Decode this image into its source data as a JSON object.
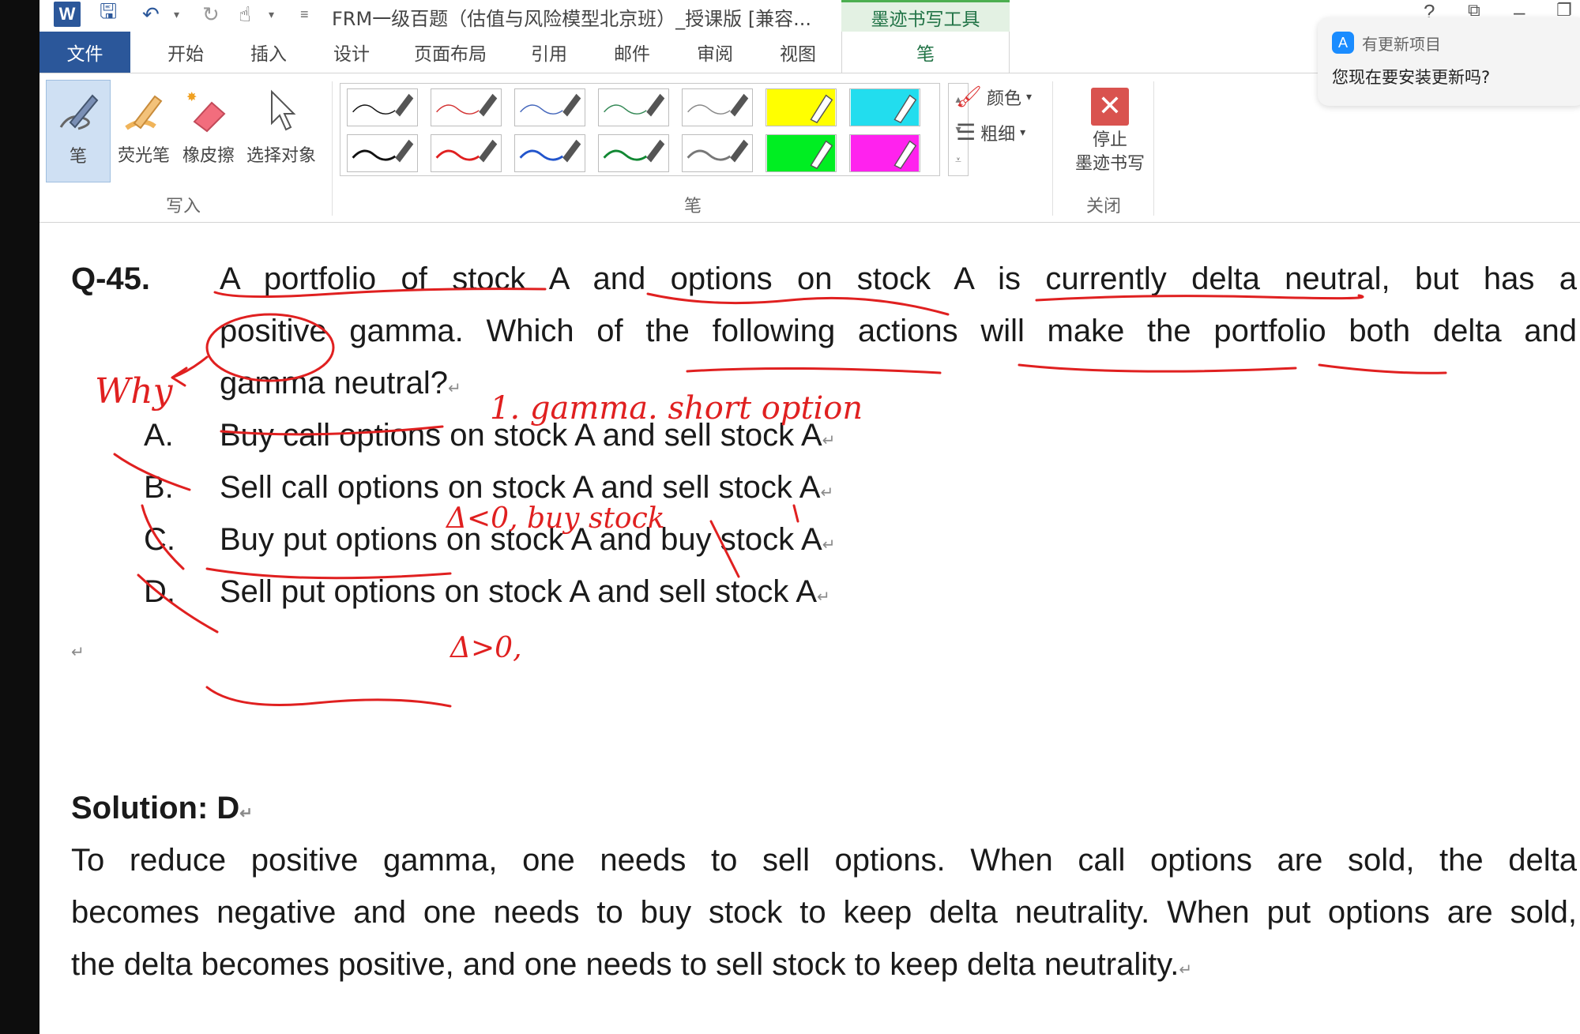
{
  "titlebar": {
    "title": "FRM一级百题（估值与风险模型北京班）_授课版 [兼容...",
    "context_tab": "墨迹书写工具",
    "help": "?"
  },
  "tabs": [
    {
      "label": "文件"
    },
    {
      "label": "开始"
    },
    {
      "label": "插入"
    },
    {
      "label": "设计"
    },
    {
      "label": "页面布局"
    },
    {
      "label": "引用"
    },
    {
      "label": "邮件"
    },
    {
      "label": "审阅"
    },
    {
      "label": "视图"
    },
    {
      "label": "笔"
    }
  ],
  "ribbon": {
    "write_group": {
      "label": "写入",
      "buttons": [
        {
          "label": "笔",
          "icon": "pen-icon"
        },
        {
          "label": "荧光笔",
          "icon": "highlighter-icon"
        },
        {
          "label": "橡皮擦",
          "icon": "eraser-icon"
        },
        {
          "label": "选择对象",
          "icon": "cursor-icon"
        }
      ]
    },
    "pens_group": {
      "label": "笔",
      "color_label": "颜色",
      "thickness_label": "粗细",
      "pens": [
        {
          "color": "#111111",
          "kind": "thin"
        },
        {
          "color": "#d33333",
          "kind": "thin"
        },
        {
          "color": "#4466bb",
          "kind": "thin"
        },
        {
          "color": "#338855",
          "kind": "thin"
        },
        {
          "color": "#888888",
          "kind": "thin"
        },
        {
          "color": "#ffff00",
          "kind": "highlighter"
        },
        {
          "color": "#22ddee",
          "kind": "highlighter"
        },
        {
          "color": "#111111",
          "kind": "thick"
        },
        {
          "color": "#e02020",
          "kind": "thick"
        },
        {
          "color": "#2255cc",
          "kind": "thick"
        },
        {
          "color": "#118833",
          "kind": "thick"
        },
        {
          "color": "#777777",
          "kind": "thick"
        },
        {
          "color": "#00ee22",
          "kind": "highlighter"
        },
        {
          "color": "#ff22ee",
          "kind": "highlighter"
        }
      ]
    },
    "close_group": {
      "label": "关闭",
      "stop_line1": "停止",
      "stop_line2": "墨迹书写"
    }
  },
  "notification": {
    "app": "有更新项目",
    "message": "您现在要安装更新吗?"
  },
  "document": {
    "qnum": "Q-45.",
    "question_lines": [
      "A portfolio of stock A and options on stock A is currently delta neutral, but has a",
      "positive gamma. Which of the following actions will make the portfolio both delta and",
      "gamma neutral?"
    ],
    "options": [
      {
        "letter": "A.",
        "text": "Buy call options on stock A and sell stock A"
      },
      {
        "letter": "B.",
        "text": "Sell call options on stock A and sell stock A"
      },
      {
        "letter": "C.",
        "text": "Buy put options on stock A and buy stock A"
      },
      {
        "letter": "D.",
        "text": "Sell put options on stock A and sell stock A"
      }
    ],
    "paragraph_mark": "↵",
    "solution": "Solution: D",
    "explanation_lines": [
      "To reduce positive gamma, one needs to sell options. When call options are sold, the delta",
      "becomes negative and one needs to buy stock to keep delta neutrality. When put options are sold,",
      "the delta becomes positive, and one needs to sell stock to keep delta neutrality."
    ]
  },
  "ink_annotations": {
    "why": "Why",
    "note1": "1. gamma. short option",
    "note2": "Δ<0, buy stock",
    "note3": "Δ>0,"
  }
}
